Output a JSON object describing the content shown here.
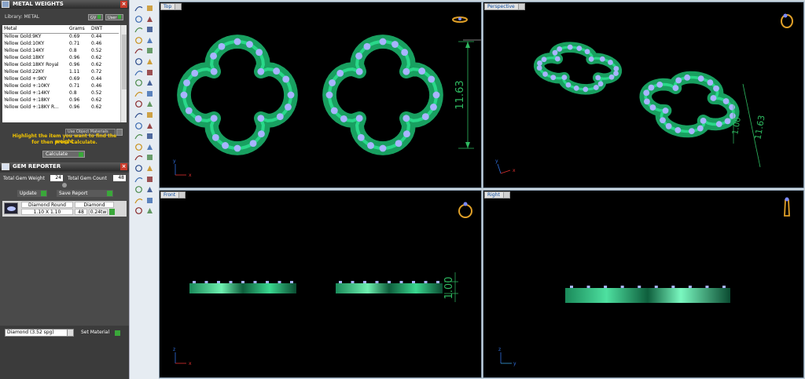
{
  "metal_panel": {
    "title": "METAL WEIGHTS",
    "library_label": "Library: METAL",
    "gv_button": "GV",
    "user_button": "User",
    "columns": [
      "Metal",
      "Grams",
      "DWT"
    ],
    "rows": [
      {
        "metal": "Yellow Gold:9KY",
        "grams": "0.69",
        "dwt": "0.44"
      },
      {
        "metal": "Yellow Gold:10KY",
        "grams": "0.71",
        "dwt": "0.46"
      },
      {
        "metal": "Yellow Gold:14KY",
        "grams": "0.8",
        "dwt": "0.52"
      },
      {
        "metal": "Yellow Gold:18KY",
        "grams": "0.96",
        "dwt": "0.62"
      },
      {
        "metal": "Yellow Gold:18KY Royal",
        "grams": "0.96",
        "dwt": "0.62"
      },
      {
        "metal": "Yellow Gold:22KY",
        "grams": "1.11",
        "dwt": "0.72"
      },
      {
        "metal": "Yellow Gold +:9KY",
        "grams": "0.69",
        "dwt": "0.44"
      },
      {
        "metal": "Yellow Gold +:10KY",
        "grams": "0.71",
        "dwt": "0.46"
      },
      {
        "metal": "Yellow Gold +:14KY",
        "grams": "0.8",
        "dwt": "0.52"
      },
      {
        "metal": "Yellow Gold +:18KY",
        "grams": "0.96",
        "dwt": "0.62"
      },
      {
        "metal": "Yellow Gold +:18KY R...",
        "grams": "0.96",
        "dwt": "0.62"
      }
    ],
    "use_object_material": "Use Object Materials",
    "hint_line1": "Highlight the item you want to find the weight",
    "hint_line2": "for then press Calculate.",
    "calculate_button": "Calculate"
  },
  "gem_panel": {
    "title": "GEM REPORTER",
    "total_weight_label": "Total Gem Weight",
    "total_weight_value": "24",
    "total_count_label": "Total Gem Count",
    "total_count_value": "48",
    "update_button": "Update",
    "save_report_button": "Save Report",
    "row": {
      "shape": "Diamond Round",
      "material": "Diamond",
      "size": "1.10 X 1.10",
      "count": "48",
      "weight": "0.24tw"
    }
  },
  "material_select": {
    "value": "Diamond    (3.52 spg)"
  },
  "set_material_button": "Set Material",
  "viewports": {
    "top": {
      "label": "Top",
      "dimension": "11.63"
    },
    "perspective": {
      "label": "Perspective",
      "dimension_a": "1.00",
      "dimension_b": "11.63"
    },
    "front": {
      "label": "Front",
      "dimension": "1.00"
    },
    "right": {
      "label": "Right"
    }
  },
  "axes": {
    "x": "x",
    "y": "y",
    "z": "z"
  },
  "colors": {
    "metal_green": "#18a060",
    "gem_blue": "#a8b4ff",
    "dimension_green": "#2eba60",
    "hint_yellow": "#f2c400"
  }
}
